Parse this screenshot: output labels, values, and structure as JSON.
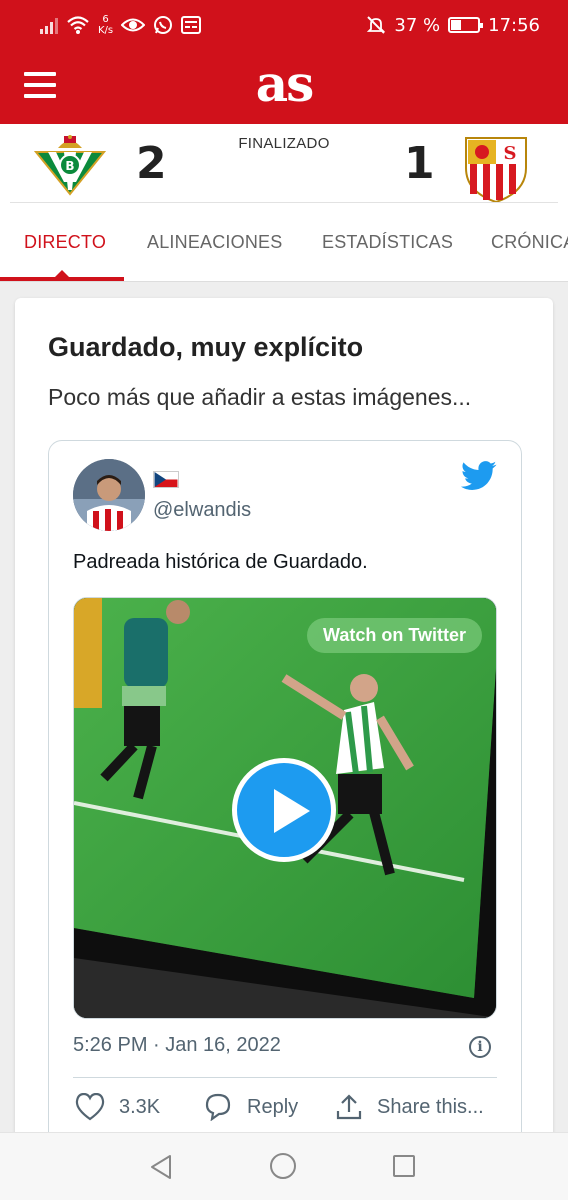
{
  "status_bar": {
    "net_speed_value": "6",
    "net_speed_unit": "K/s",
    "battery_percent": "37 %",
    "battery_level": 0.37,
    "time": "17:56"
  },
  "header": {
    "logo_text": "as",
    "brand_color": "#d0111b"
  },
  "match": {
    "status": "FINALIZADO",
    "home_score": "2",
    "away_score": "1",
    "home_crest_icon": "real-betis-crest",
    "away_crest_icon": "sevilla-fc-crest"
  },
  "tabs": [
    {
      "label": "DIRECTO",
      "active": true
    },
    {
      "label": "ALINEACIONES",
      "active": false
    },
    {
      "label": "ESTADÍSTICAS",
      "active": false
    },
    {
      "label": "CRÓNICA",
      "active": false
    }
  ],
  "post": {
    "title": "Guardado, muy explícito",
    "body": "Poco más que añadir a estas imágenes..."
  },
  "tweet": {
    "handle": "@elwandis",
    "flag_icon": "czech-flag-icon",
    "text": "Padreada histórica de Guardado.",
    "watch_label": "Watch on Twitter",
    "timestamp": "5:26 PM · Jan 16, 2022",
    "like_count": "3.3K",
    "reply_label": "Reply",
    "share_label": "Share this...",
    "accent_color": "#1d9bf0"
  }
}
